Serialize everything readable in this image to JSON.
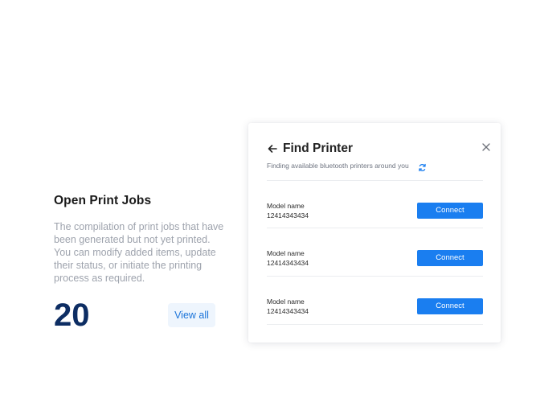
{
  "summary": {
    "title": "Open Print Jobs",
    "description": "The compilation of print jobs that have been generated but not yet printed. You can modify added items, update their status, or initiate the printing process as required.",
    "count": "20",
    "view_all_label": "View all"
  },
  "modal": {
    "title": "Find Printer",
    "subtitle": "Finding available bluetooth printers around you",
    "back_icon": "arrow-left-icon",
    "close_icon": "close-icon",
    "refresh_icon": "refresh-icon",
    "printers": [
      {
        "name": "Model name",
        "id": "12414343434",
        "connect_label": "Connect"
      },
      {
        "name": "Model name",
        "id": "12414343434",
        "connect_label": "Connect"
      },
      {
        "name": "Model name",
        "id": "12414343434",
        "connect_label": "Connect"
      }
    ]
  },
  "colors": {
    "accent": "#1a7ef0",
    "count_color": "#0d2d63",
    "view_all_bg": "#eef5fd"
  }
}
